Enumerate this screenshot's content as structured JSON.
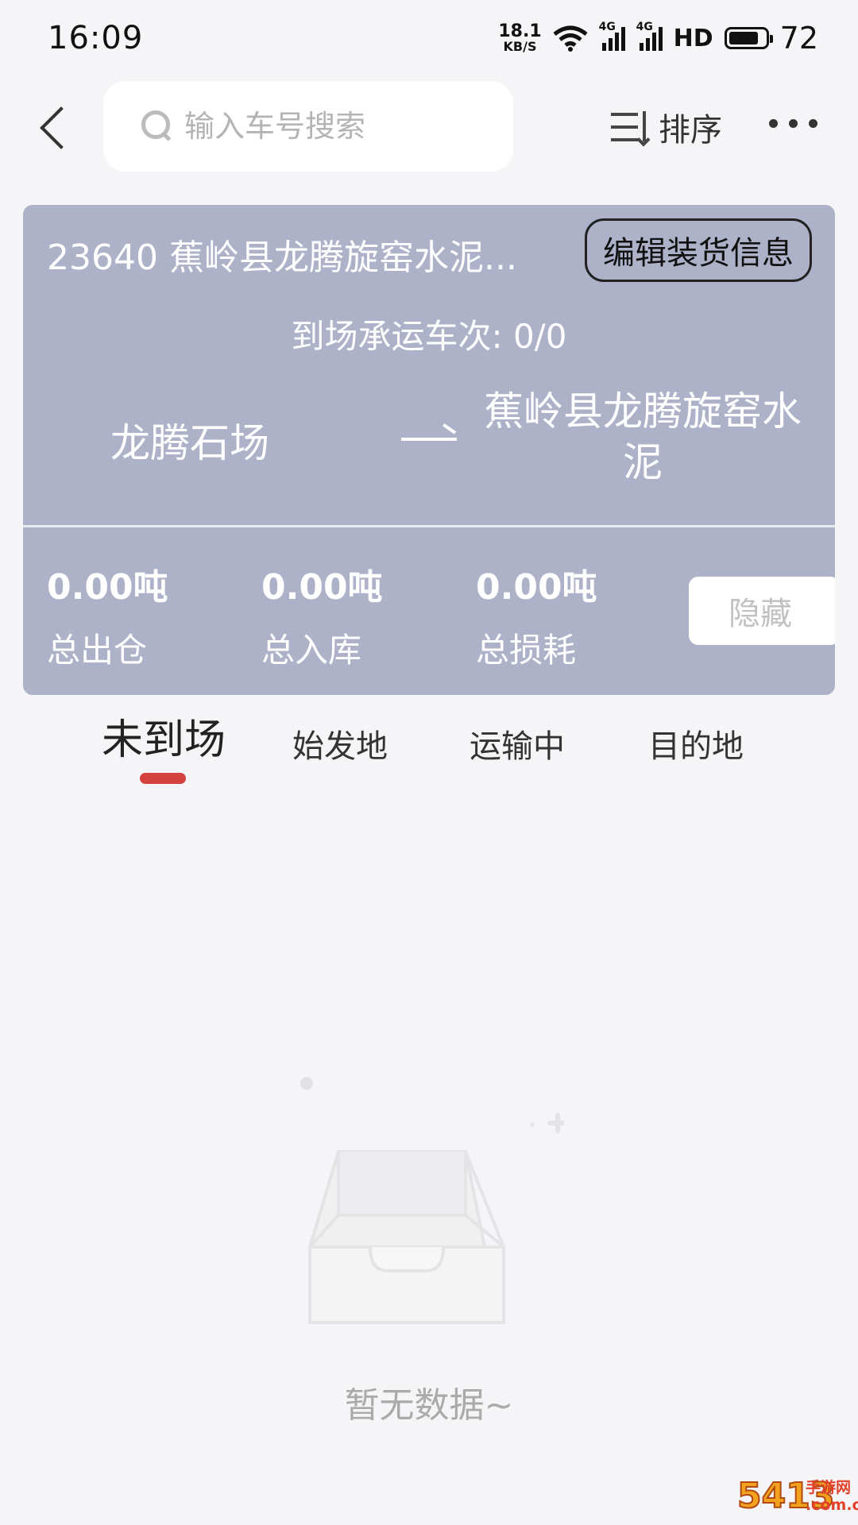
{
  "status_bar": {
    "time": "16:09",
    "net_speed_value": "18.1",
    "net_speed_unit": "KB/S",
    "signal1_tag": "4G",
    "signal2_tag": "4G",
    "hd": "HD",
    "battery": "72"
  },
  "header": {
    "search_placeholder": "输入车号搜索",
    "sort_label": "排序"
  },
  "card": {
    "title": "23640 蕉岭县龙腾旋窑水泥...",
    "edit_button": "编辑装货信息",
    "trips": "到场承运车次: 0/0",
    "origin": "龙腾石场",
    "destination": "蕉岭县龙腾旋窑水泥",
    "stats": [
      {
        "value": "0.00吨",
        "label": "总出仓"
      },
      {
        "value": "0.00吨",
        "label": "总入库"
      },
      {
        "value": "0.00吨",
        "label": "总损耗"
      }
    ],
    "hide_button": "隐藏"
  },
  "tabs": [
    {
      "label": "未到场",
      "active": true
    },
    {
      "label": "始发地"
    },
    {
      "label": "运输中"
    },
    {
      "label": "目的地"
    }
  ],
  "empty_state": {
    "text": "暂无数据~",
    "icon": "empty-box-icon"
  },
  "watermark": {
    "big": "5413",
    "line1": "手游网",
    "line2": ".com.cn"
  },
  "colors": {
    "card_bg": "#adb2c9",
    "tab_indicator": "#d5413f",
    "page_bg": "#f5f5f7"
  }
}
